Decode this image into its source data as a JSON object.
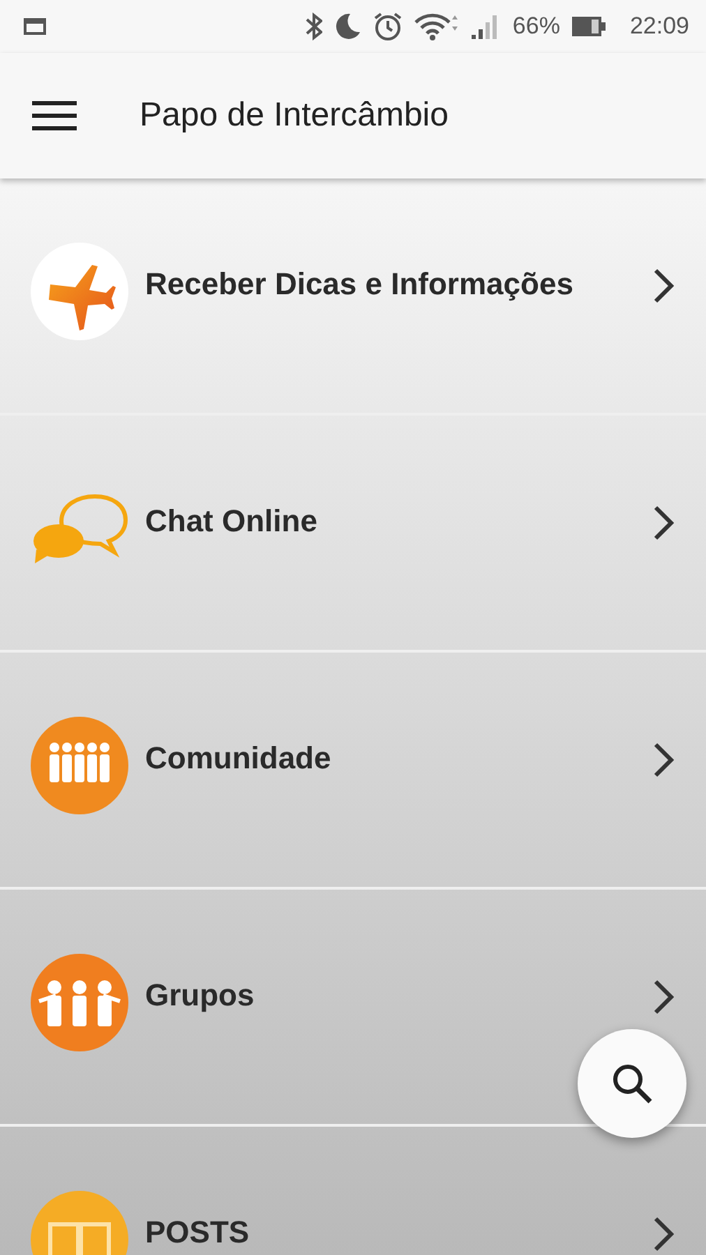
{
  "status_bar": {
    "battery": "66%",
    "time": "22:09"
  },
  "app_bar": {
    "title": "Papo de Intercâmbio"
  },
  "menu": [
    {
      "label": "Receber Dicas e Informações"
    },
    {
      "label": "Chat Online"
    },
    {
      "label": "Comunidade"
    },
    {
      "label": "Grupos"
    },
    {
      "label": "POSTS"
    }
  ]
}
